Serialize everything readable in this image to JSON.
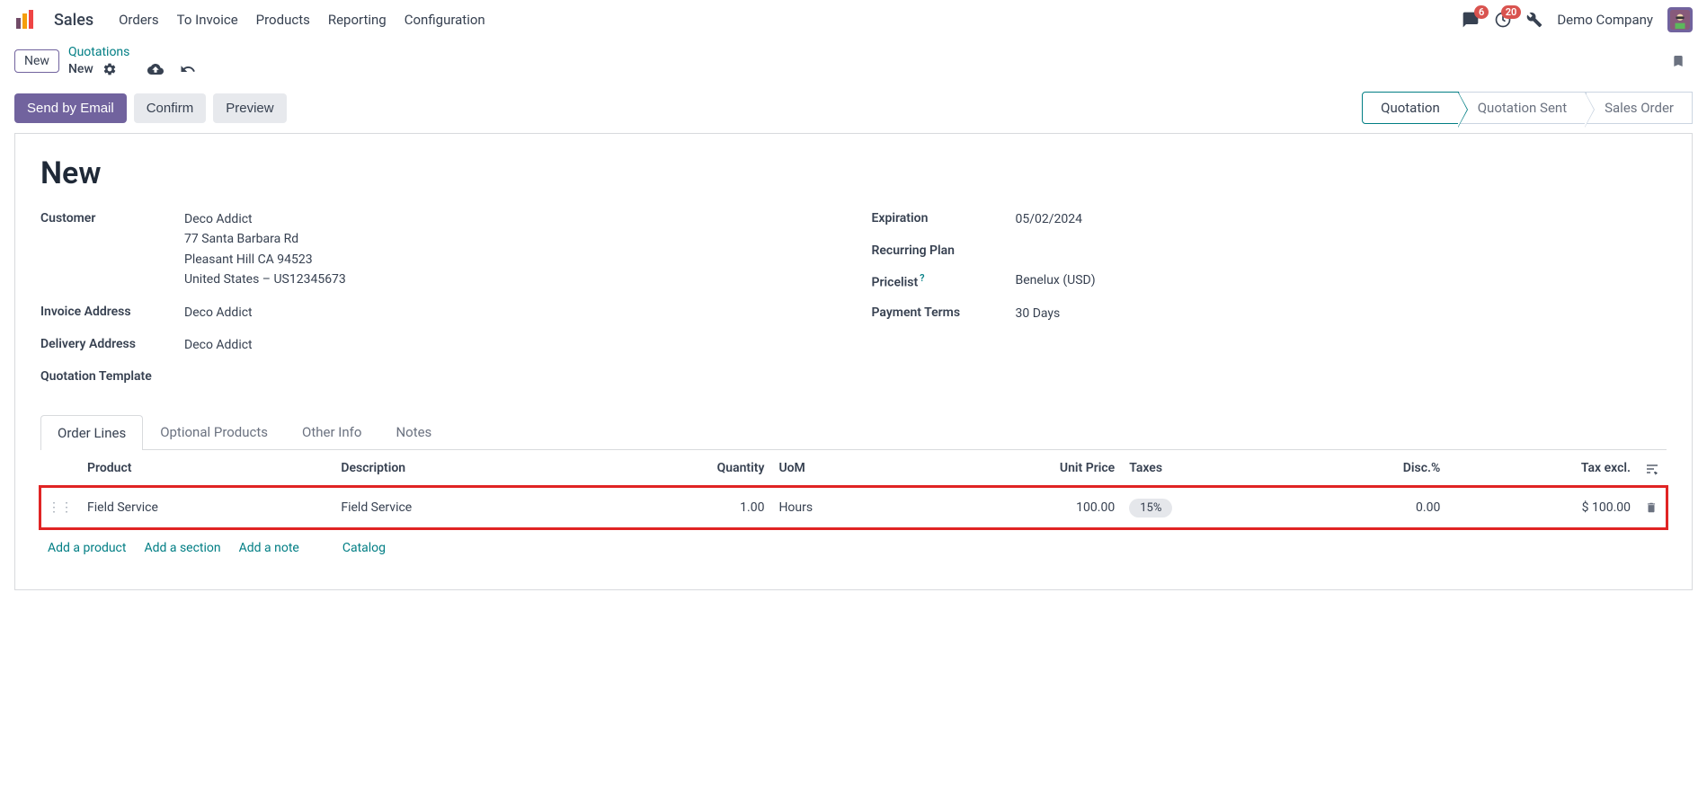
{
  "topbar": {
    "app_name": "Sales",
    "nav": [
      "Orders",
      "To Invoice",
      "Products",
      "Reporting",
      "Configuration"
    ],
    "msg_badge": "6",
    "activity_badge": "20",
    "company": "Demo Company"
  },
  "breadcrumb": {
    "new_badge": "New",
    "parent": "Quotations",
    "current": "New"
  },
  "actions": {
    "send_email": "Send by Email",
    "confirm": "Confirm",
    "preview": "Preview"
  },
  "status": {
    "steps": [
      "Quotation",
      "Quotation Sent",
      "Sales Order"
    ]
  },
  "form": {
    "title": "New",
    "left": {
      "customer_label": "Customer",
      "customer_name": "Deco Addict",
      "customer_addr1": "77 Santa Barbara Rd",
      "customer_addr2": "Pleasant Hill CA 94523",
      "customer_addr3": "United States – US12345673",
      "invoice_addr_label": "Invoice Address",
      "invoice_addr": "Deco Addict",
      "delivery_addr_label": "Delivery Address",
      "delivery_addr": "Deco Addict",
      "quote_tmpl_label": "Quotation Template"
    },
    "right": {
      "expiration_label": "Expiration",
      "expiration": "05/02/2024",
      "recurring_label": "Recurring Plan",
      "pricelist_label": "Pricelist",
      "pricelist": "Benelux (USD)",
      "payment_terms_label": "Payment Terms",
      "payment_terms": "30 Days"
    }
  },
  "tabs": [
    "Order Lines",
    "Optional Products",
    "Other Info",
    "Notes"
  ],
  "table": {
    "headers": {
      "product": "Product",
      "description": "Description",
      "quantity": "Quantity",
      "uom": "UoM",
      "unit_price": "Unit Price",
      "taxes": "Taxes",
      "disc": "Disc.%",
      "tax_excl": "Tax excl."
    },
    "row": {
      "product": "Field Service",
      "description": "Field Service",
      "quantity": "1.00",
      "uom": "Hours",
      "unit_price": "100.00",
      "taxes": "15%",
      "disc": "0.00",
      "tax_excl": "$ 100.00"
    }
  },
  "line_actions": {
    "add_product": "Add a product",
    "add_section": "Add a section",
    "add_note": "Add a note",
    "catalog": "Catalog"
  }
}
